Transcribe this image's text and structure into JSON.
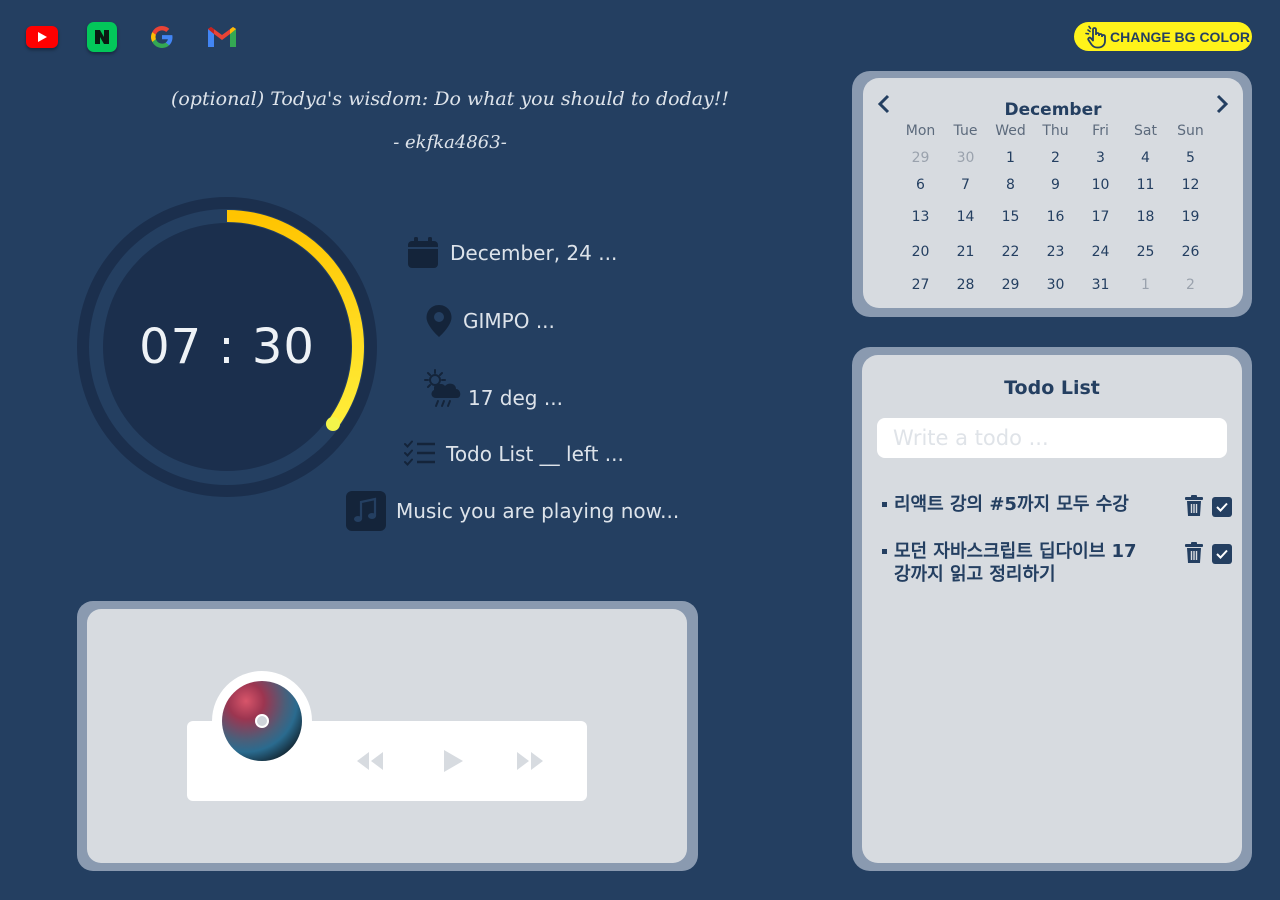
{
  "shortcuts": {
    "youtube_letter": "",
    "naver_letter": "N"
  },
  "header": {
    "change_bg_label": "CHANGE BG COLOR"
  },
  "wisdom": {
    "quote": "(optional) Todya's wisdom: Do what you should to doday!!",
    "author": "- ekfka4863-"
  },
  "clock": {
    "time": "07 : 30",
    "progress": 0.35
  },
  "info": {
    "date": "December, 24 ...",
    "location": "GIMPO ...",
    "weather": "17 deg ...",
    "todo_summary": "Todo List __ left ...",
    "music": "Music you are playing now..."
  },
  "calendar": {
    "month": "December",
    "weekdays": [
      "Mon",
      "Tue",
      "Wed",
      "Thu",
      "Fri",
      "Sat",
      "Sun"
    ],
    "weeks": [
      [
        "29",
        "30",
        "1",
        "2",
        "3",
        "4",
        "5"
      ],
      [
        "6",
        "7",
        "8",
        "9",
        "10",
        "11",
        "12"
      ],
      [
        "13",
        "14",
        "15",
        "16",
        "17",
        "18",
        "19"
      ],
      [
        "20",
        "21",
        "22",
        "23",
        "24",
        "25",
        "26"
      ],
      [
        "27",
        "28",
        "29",
        "30",
        "31",
        "1",
        "2"
      ]
    ]
  },
  "todo": {
    "title": "Todo List",
    "placeholder": "Write a todo ...",
    "items": [
      {
        "text": "리액트 강의 #5까지 모두 수강"
      },
      {
        "text": "모던 자바스크립트 딥다이브 17강까지 읽고 정리하기"
      }
    ]
  },
  "colors": {
    "background": "#243f61",
    "accent_yellow": "#fff31a",
    "panel": "#d7dbe0",
    "panel_border": "#8a9ab0"
  }
}
